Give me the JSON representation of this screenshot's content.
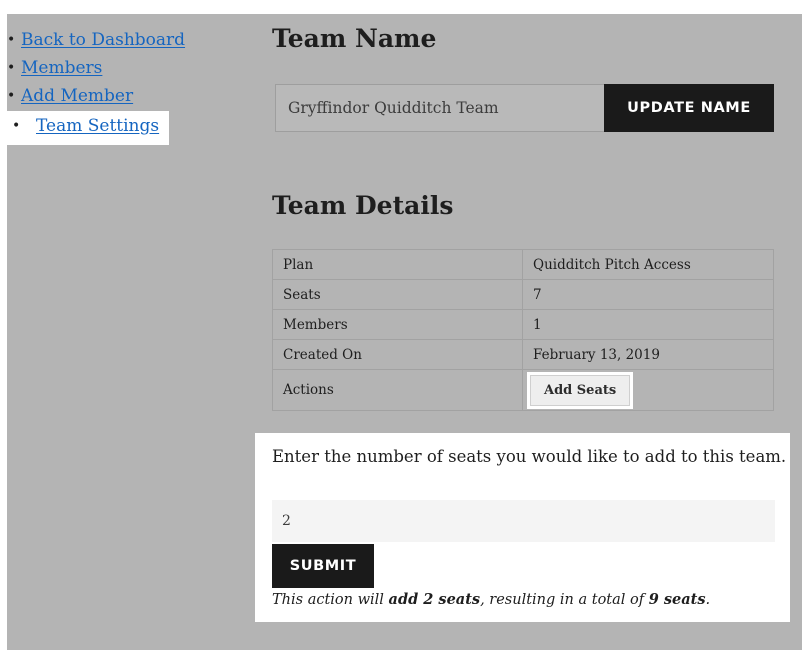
{
  "sidebar": {
    "items": [
      {
        "label": "Back to Dashboard",
        "active": false
      },
      {
        "label": "Members",
        "active": false
      },
      {
        "label": "Add Member",
        "active": false
      },
      {
        "label": "Team Settings",
        "active": true
      }
    ],
    "bullet": "•"
  },
  "team_name": {
    "title": "Team Name",
    "input_value": "Gryffindor Quidditch Team",
    "update_label": "UPDATE NAME"
  },
  "team_details": {
    "title": "Team Details",
    "rows": [
      {
        "label": "Plan",
        "value": "Quidditch Pitch Access"
      },
      {
        "label": "Seats",
        "value": "7"
      },
      {
        "label": "Members",
        "value": "1"
      },
      {
        "label": "Created On",
        "value": "February 13, 2019"
      }
    ],
    "actions_label": "Actions",
    "add_seats_label": "Add Seats"
  },
  "add_seats_panel": {
    "prompt": "Enter the number of seats you would like to add to this team.",
    "input_value": "2",
    "submit_label": "SUBMIT",
    "summary": {
      "prefix": "This action will ",
      "add_text": "add 2 seats",
      "middle": ", resulting in a total of ",
      "total_text": "9 seats",
      "suffix": "."
    }
  },
  "colors": {
    "overlay": "#b4b4b4",
    "link": "#1565c0",
    "button_dark": "#1a1a1a",
    "highlight": "#ffffff"
  }
}
